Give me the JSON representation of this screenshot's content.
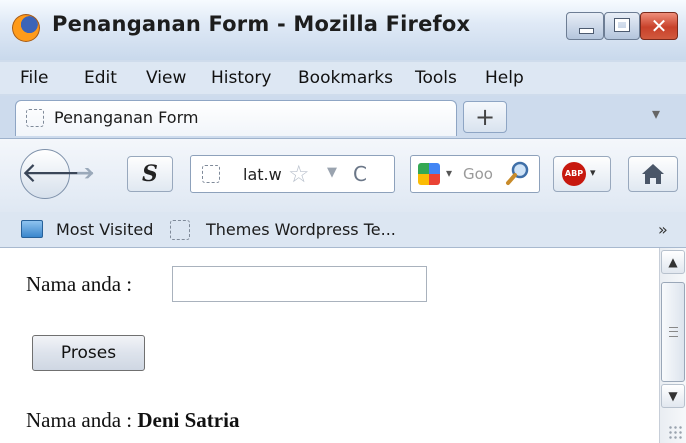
{
  "window": {
    "title": "Penanganan Form - Mozilla Firefox",
    "close_glyph": "✕"
  },
  "menu": {
    "items": [
      {
        "label": "File"
      },
      {
        "label": "Edit"
      },
      {
        "label": "View"
      },
      {
        "label": "History"
      },
      {
        "label": "Bookmarks"
      },
      {
        "label": "Tools"
      },
      {
        "label": "Help"
      }
    ]
  },
  "tabs": {
    "active_label": "Penanganan Form",
    "new_tab_glyph": "+",
    "tab_list_glyph": "▾"
  },
  "navbar": {
    "back_glyph": "🡐",
    "forward_glyph": "➔",
    "s_button_label": "S",
    "url": "lat.w",
    "star_glyph": "☆",
    "url_drop_glyph": "▼",
    "reload_glyph": "C",
    "search_placeholder": "Goo",
    "search_drop_glyph": "▾",
    "abp_label": "ABP",
    "abp_drop_glyph": "▾"
  },
  "bookmarks": {
    "items": [
      {
        "label": "Most Visited"
      },
      {
        "label": "Themes Wordpress Te..."
      }
    ],
    "overflow_glyph": "»"
  },
  "page": {
    "name_label": "Nama anda :",
    "name_input_value": "",
    "submit_label": "Proses",
    "result_label": "Nama anda :",
    "result_value": "Deni Satria"
  },
  "scrollbar": {
    "up_glyph": "▲",
    "down_glyph": "▼"
  },
  "colors": {
    "titlebar": "#dfe9f6",
    "close_button": "#c8412a",
    "menubar": "#dde7f3",
    "abp_badge": "#c7180e"
  }
}
